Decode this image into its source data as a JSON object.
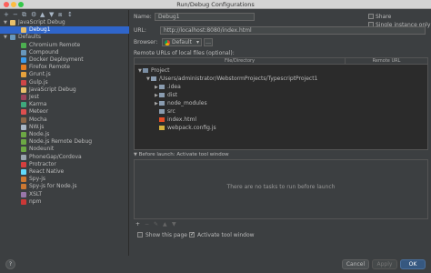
{
  "window": {
    "title": "Run/Debug Configurations"
  },
  "left_toolbar": [
    "+",
    "−",
    "⧉",
    "⚙",
    "▲",
    "▼",
    "⧈",
    "↕"
  ],
  "tree": [
    {
      "label": "JavaScript Debug",
      "level": 0,
      "expanded": true,
      "icon_color": "#e8bf6a"
    },
    {
      "label": "Debug1",
      "level": 1,
      "selected": true,
      "icon_color": "#e8bf6a"
    },
    {
      "label": "Defaults",
      "level": 0,
      "expanded": true,
      "icon_color": "#6897bb"
    },
    {
      "label": "Chromium Remote",
      "level": 1,
      "icon_color": "#4caf50"
    },
    {
      "label": "Compound",
      "level": 1,
      "icon_color": "#6897bb"
    },
    {
      "label": "Docker Deployment",
      "level": 1,
      "icon_color": "#3d9be9"
    },
    {
      "label": "Firefox Remote",
      "level": 1,
      "icon_color": "#e67e22"
    },
    {
      "label": "Grunt.js",
      "level": 1,
      "icon_color": "#e6a23c"
    },
    {
      "label": "Gulp.js",
      "level": 1,
      "icon_color": "#cf4647"
    },
    {
      "label": "JavaScript Debug",
      "level": 1,
      "icon_color": "#e8bf6a"
    },
    {
      "label": "Jest",
      "level": 1,
      "icon_color": "#99425b"
    },
    {
      "label": "Karma",
      "level": 1,
      "icon_color": "#3fa97d"
    },
    {
      "label": "Meteor",
      "level": 1,
      "icon_color": "#de4f4f"
    },
    {
      "label": "Mocha",
      "level": 1,
      "icon_color": "#8d6748"
    },
    {
      "label": "NW.js",
      "level": 1,
      "icon_color": "#a9b7c6"
    },
    {
      "label": "Node.js",
      "level": 1,
      "icon_color": "#6ca844"
    },
    {
      "label": "Node.js Remote Debug",
      "level": 1,
      "icon_color": "#6ca844"
    },
    {
      "label": "Nodeunit",
      "level": 1,
      "icon_color": "#6ca844"
    },
    {
      "label": "PhoneGap/Cordova",
      "level": 1,
      "icon_color": "#9aa4ad"
    },
    {
      "label": "Protractor",
      "level": 1,
      "icon_color": "#d53f3f"
    },
    {
      "label": "React Native",
      "level": 1,
      "icon_color": "#61dafb"
    },
    {
      "label": "Spy-js",
      "level": 1,
      "icon_color": "#cc7832"
    },
    {
      "label": "Spy-js for Node.js",
      "level": 1,
      "icon_color": "#cc7832"
    },
    {
      "label": "XSLT",
      "level": 1,
      "icon_color": "#9876aa"
    },
    {
      "label": "npm",
      "level": 1,
      "icon_color": "#cb3837"
    }
  ],
  "form": {
    "name_label": "Name:",
    "name_value": "Debug1",
    "share_label": "Share",
    "single_instance_label": "Single instance only",
    "url_label": "URL:",
    "url_value": "http://localhost:8080/index.html",
    "browser_label": "Browser:",
    "browser_value": "Default",
    "remote_urls_label": "Remote URLs of local files (optional):",
    "col_file": "File/Directory",
    "col_remote": "Remote URL"
  },
  "files": [
    {
      "label": "Project",
      "indent": 0,
      "arrow": "▼",
      "type": "project"
    },
    {
      "label": "/Users/administrator/WebstormProjects/TypescriptProject1",
      "indent": 1,
      "arrow": "▼",
      "type": "folder"
    },
    {
      "label": ".idea",
      "indent": 2,
      "arrow": "▶",
      "type": "folder"
    },
    {
      "label": "dist",
      "indent": 2,
      "arrow": "▶",
      "type": "folder"
    },
    {
      "label": "node_modules",
      "indent": 2,
      "arrow": "▶",
      "type": "folder"
    },
    {
      "label": "src",
      "indent": 2,
      "arrow": "",
      "type": "folder"
    },
    {
      "label": "index.html",
      "indent": 2,
      "arrow": "",
      "type": "html"
    },
    {
      "label": "webpack.config.js",
      "indent": 2,
      "arrow": "",
      "type": "js"
    }
  ],
  "before_launch": {
    "header": "Before launch: Activate tool window",
    "empty_text": "There are no tasks to run before launch",
    "toolbar": [
      "+",
      "−",
      "✎",
      "▲",
      "▼"
    ]
  },
  "options": {
    "show_page_label": "Show this page",
    "activate_tool_label": "Activate tool window"
  },
  "buttons": {
    "help": "?",
    "cancel": "Cancel",
    "apply": "Apply",
    "ok": "OK"
  },
  "colors": {
    "accent": "#2f65ca",
    "folder": "#8a9cb0"
  }
}
